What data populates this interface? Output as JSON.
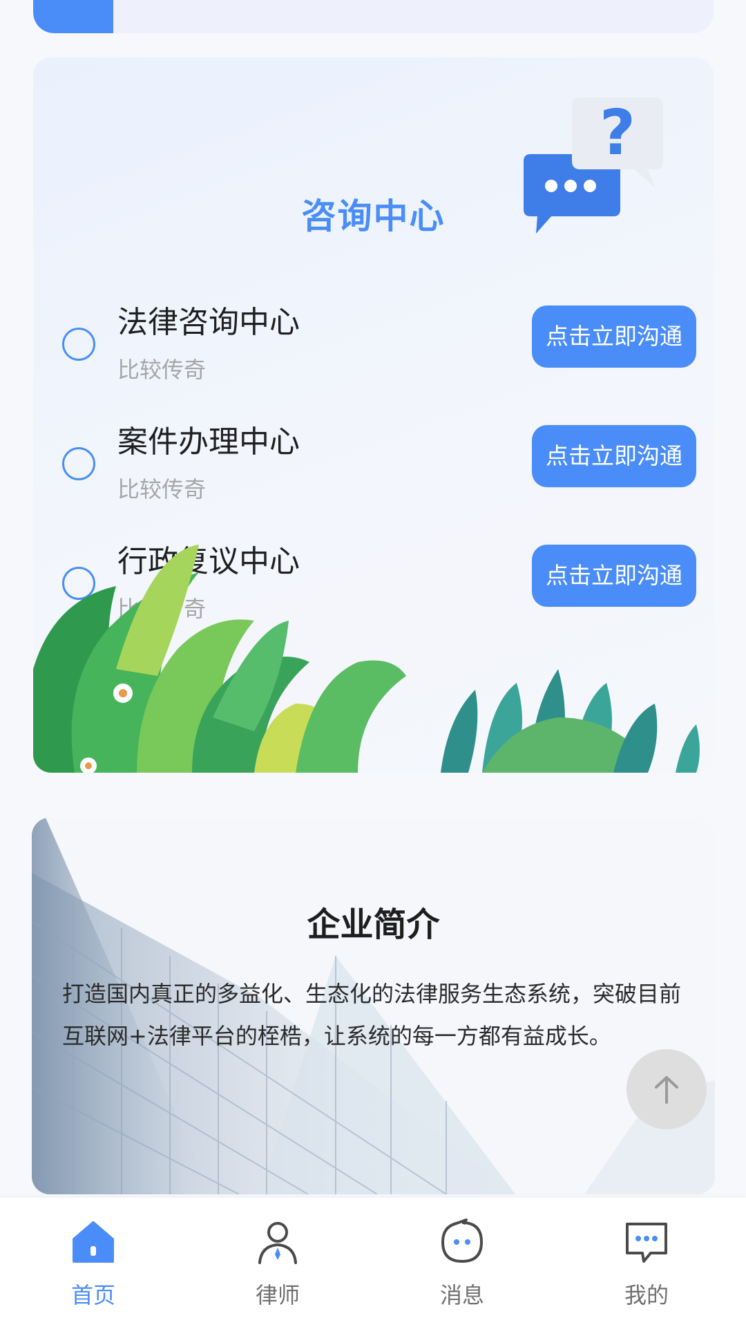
{
  "consult": {
    "title": "咨询中心",
    "items": [
      {
        "title": "法律咨询中心",
        "subtitle": "比较传奇",
        "button": "点击立即沟通"
      },
      {
        "title": "案件办理中心",
        "subtitle": "比较传奇",
        "button": "点击立即沟通"
      },
      {
        "title": "行政复议中心",
        "subtitle": "比较传奇",
        "button": "点击立即沟通"
      }
    ]
  },
  "intro": {
    "title": "企业简介",
    "text": "打造国内真正的多益化、生态化的法律服务生态系统，突破目前互联网+法律平台的桎梏，让系统的每一方都有益成长。"
  },
  "tabbar": {
    "items": [
      {
        "label": "首页",
        "icon": "home-icon",
        "active": true
      },
      {
        "label": "律师",
        "icon": "lawyer-icon",
        "active": false
      },
      {
        "label": "消息",
        "icon": "message-icon",
        "active": false
      },
      {
        "label": "我的",
        "icon": "mine-icon",
        "active": false
      }
    ]
  },
  "colors": {
    "accent": "#4a8df8",
    "muted": "#a6a6a6"
  }
}
